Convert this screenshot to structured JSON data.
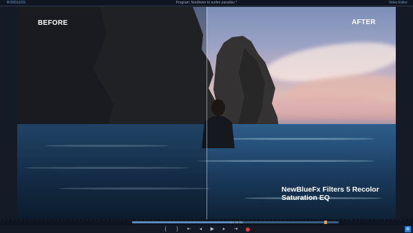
{
  "window": {
    "title": "Program: Nordbeier to surfen paradiso *",
    "left_label": "BORDLESS",
    "right_label": "Video Editor"
  },
  "viewer": {
    "before_label": "BEFORE",
    "after_label": "AFTER",
    "caption_line1": "NewBlueFx Filters 5 Recolor",
    "caption_line2": "Saturation EQ",
    "split_position": 0.5
  },
  "timeline": {
    "timecode": "00:00:00",
    "progress": 0.48
  },
  "transport": {
    "buttons": [
      {
        "name": "mark-in-button",
        "glyph": "{"
      },
      {
        "name": "mark-out-button",
        "glyph": "}"
      },
      {
        "name": "go-to-in-button",
        "glyph": "⇤"
      },
      {
        "name": "step-back-button",
        "glyph": "◂"
      },
      {
        "name": "play-button",
        "glyph": "▶"
      },
      {
        "name": "step-forward-button",
        "glyph": "▸"
      },
      {
        "name": "go-to-out-button",
        "glyph": "⇥"
      }
    ],
    "record_color": "#e23a3a"
  },
  "colors": {
    "accent": "#2a7fd6",
    "in_marker": "#e6a23c"
  }
}
